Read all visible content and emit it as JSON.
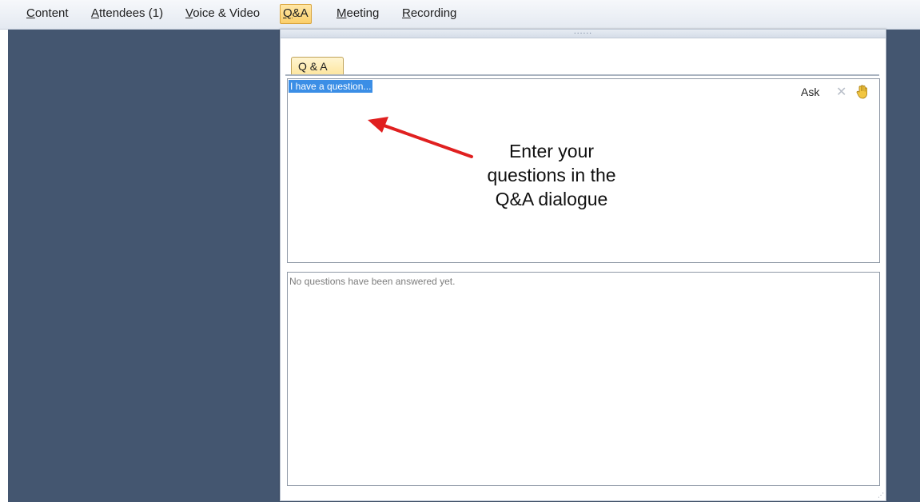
{
  "menubar": {
    "items": [
      {
        "underline": "C",
        "rest": "ontent"
      },
      {
        "underline": "A",
        "rest": "ttendees (1)"
      },
      {
        "underline": "V",
        "rest": "oice & Video"
      },
      {
        "underline": "Q",
        "rest": "&A"
      },
      {
        "underline": "M",
        "rest": "eeting"
      },
      {
        "underline": "R",
        "rest": "ecording"
      }
    ],
    "active_index": 3
  },
  "panel": {
    "grip": "......",
    "tab_label": "Q & A",
    "ask_input_value": "I have a question...",
    "ask_label": "Ask",
    "close_glyph": "✕",
    "annotation_lines": [
      "Enter your",
      "questions in the",
      "Q&A dialogue"
    ],
    "answers_text": "No questions have been answered yet.",
    "resize_glyph": "⋰"
  },
  "icons": {
    "hand": "raise-hand-icon",
    "close": "close-icon",
    "arrow": "red-arrow"
  },
  "colors": {
    "workspace": "#445670",
    "active_tab": "#fbcf6a",
    "selection": "#3b8ee6",
    "arrow": "#e02020"
  }
}
